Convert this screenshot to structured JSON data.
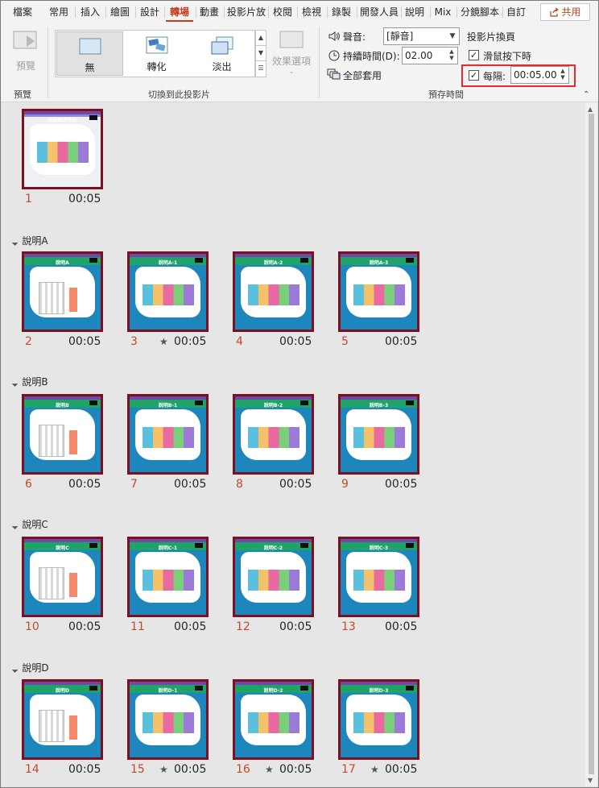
{
  "tabs": [
    "檔案",
    "常用",
    "插入",
    "繪圖",
    "設計",
    "轉場",
    "動畫",
    "投影片放",
    "校閱",
    "檢視",
    "錄製",
    "開發人員",
    "說明",
    "Mix",
    "分鏡腳本",
    "自訂"
  ],
  "active_tab": "轉場",
  "share_label": "共用",
  "ribbon": {
    "preview": {
      "button": "預覽",
      "group": "預覽"
    },
    "transitions": {
      "items": [
        {
          "label": "無",
          "icon": "none-transition-icon"
        },
        {
          "label": "轉化",
          "icon": "morph-transition-icon"
        },
        {
          "label": "淡出",
          "icon": "fade-transition-icon"
        }
      ],
      "effect_options": "效果選項",
      "group": "切換到此投影片"
    },
    "timing": {
      "sound_label": "聲音:",
      "sound_value": "[靜音]",
      "duration_label": "持續時間(D):",
      "duration_value": "02.00",
      "apply_all": "全部套用",
      "advance_title": "投影片換頁",
      "on_click": "滑鼠按下時",
      "after_label": "每隔:",
      "after_value": "00:05.00",
      "group": "預存時間"
    }
  },
  "sections": [
    "說明A",
    "說明B",
    "說明C",
    "說明D"
  ],
  "slides": [
    {
      "n": "1",
      "time": "00:05",
      "star": "",
      "title": "資訊展示平台"
    },
    {
      "n": "2",
      "time": "00:05",
      "star": "",
      "title": "說明A"
    },
    {
      "n": "3",
      "time": "00:05",
      "star": "★",
      "title": "說明A-1"
    },
    {
      "n": "4",
      "time": "00:05",
      "star": "",
      "title": "說明A-2"
    },
    {
      "n": "5",
      "time": "00:05",
      "star": "",
      "title": "說明A-3"
    },
    {
      "n": "6",
      "time": "00:05",
      "star": "",
      "title": "說明B"
    },
    {
      "n": "7",
      "time": "00:05",
      "star": "",
      "title": "說明B-1"
    },
    {
      "n": "8",
      "time": "00:05",
      "star": "",
      "title": "說明B-2"
    },
    {
      "n": "9",
      "time": "00:05",
      "star": "",
      "title": "說明B-3"
    },
    {
      "n": "10",
      "time": "00:05",
      "star": "",
      "title": "說明C"
    },
    {
      "n": "11",
      "time": "00:05",
      "star": "",
      "title": "說明C-1"
    },
    {
      "n": "12",
      "time": "00:05",
      "star": "",
      "title": "說明C-2"
    },
    {
      "n": "13",
      "time": "00:05",
      "star": "",
      "title": "說明C-3"
    },
    {
      "n": "14",
      "time": "00:05",
      "star": "",
      "title": "說明D"
    },
    {
      "n": "15",
      "time": "00:05",
      "star": "★",
      "title": "說明D-1"
    },
    {
      "n": "16",
      "time": "00:05",
      "star": "★",
      "title": "說明D-2"
    },
    {
      "n": "17",
      "time": "00:05",
      "star": "★",
      "title": "說明D-3"
    }
  ]
}
